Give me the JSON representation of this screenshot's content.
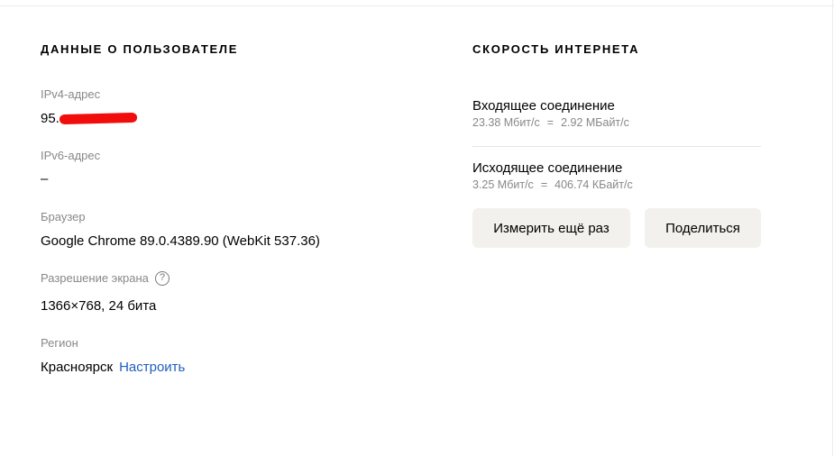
{
  "user_section": {
    "title": "ДАННЫЕ О ПОЛЬЗОВАТЕЛЕ",
    "ipv4": {
      "label": "IPv4-адрес",
      "value": "95."
    },
    "ipv6": {
      "label": "IPv6-адрес",
      "value": "–"
    },
    "browser": {
      "label": "Браузер",
      "value": "Google Chrome 89.0.4389.90 (WebKit 537.36)"
    },
    "screen": {
      "label": "Разрешение экрана",
      "help_icon": "?",
      "value": "1366×768, 24 бита"
    },
    "region": {
      "label": "Регион",
      "value": "Красноярск",
      "configure_link": "Настроить"
    }
  },
  "speed_section": {
    "title": "СКОРОСТЬ ИНТЕРНЕТА",
    "incoming": {
      "title": "Входящее соединение",
      "mbits": "23.38 Мбит/с",
      "eq": "=",
      "bytes": "2.92 МБайт/с"
    },
    "outgoing": {
      "title": "Исходящее соединение",
      "mbits": "3.25 Мбит/с",
      "eq": "=",
      "bytes": "406.74 КБайт/с"
    },
    "buttons": {
      "remeasure": "Измерить ещё раз",
      "share": "Поделиться"
    }
  },
  "colors": {
    "link": "#1f5fbd",
    "label": "#888888",
    "button_bg": "#f2f1ed",
    "redaction": "#f20d0d"
  }
}
